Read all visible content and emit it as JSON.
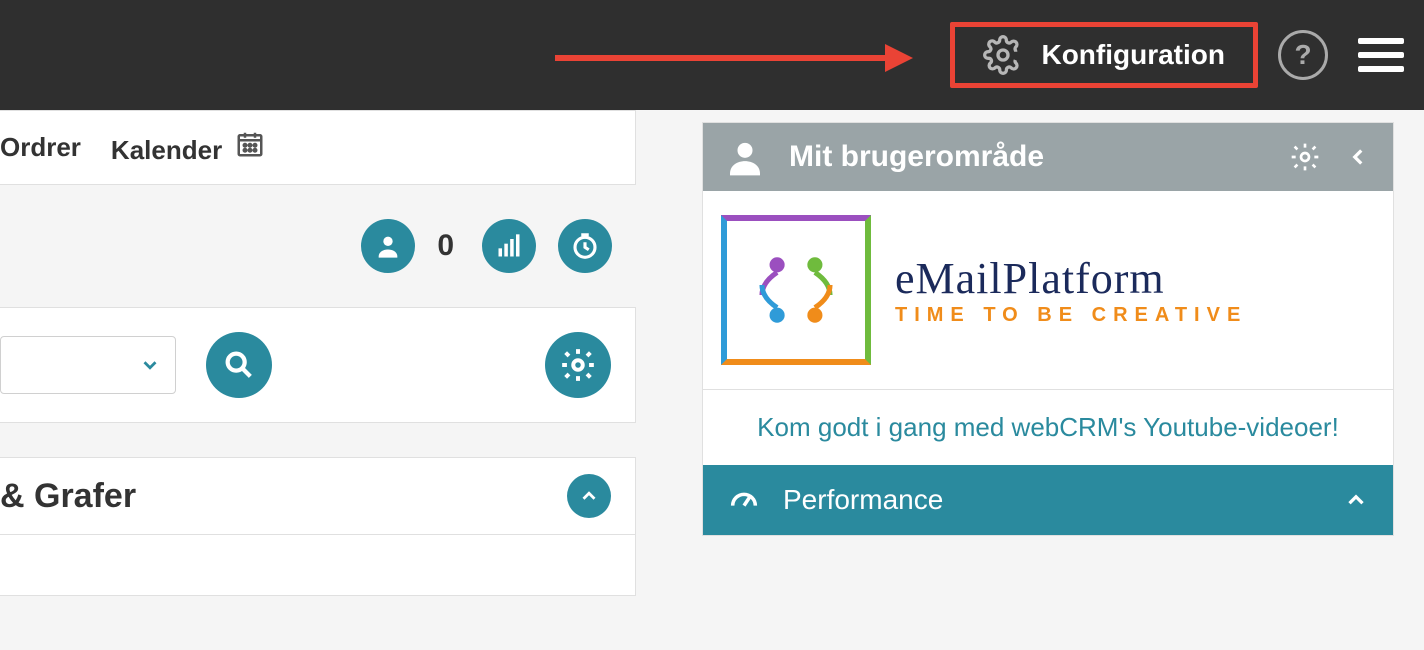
{
  "topbar": {
    "config_label": "Konfiguration"
  },
  "nav": {
    "orders": "Ordrer",
    "calendar": "Kalender"
  },
  "stats": {
    "user_count": "0"
  },
  "left_panel": {
    "graphs_title": "& Grafer"
  },
  "user_panel": {
    "title": "Mit brugerområde",
    "logo_line1": "eMailPlatform",
    "logo_line2": "TIME TO BE CREATIVE",
    "youtube_link": "Kom godt i gang med webCRM's Youtube-videoer!",
    "performance": "Performance"
  },
  "colors": {
    "teal": "#2a8a9e",
    "highlight": "#ea4335",
    "header_gray": "#9aa4a7"
  }
}
